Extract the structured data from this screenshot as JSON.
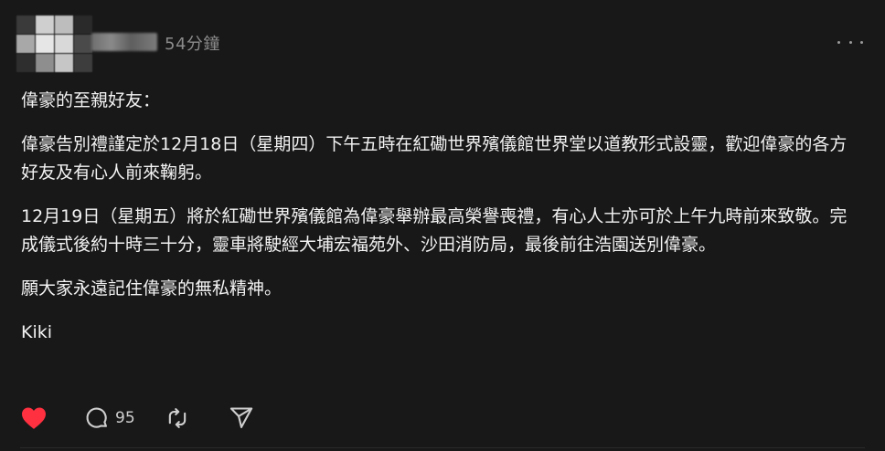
{
  "header": {
    "timestamp": "54分鐘",
    "more_icon": "more-horizontal-icon"
  },
  "post": {
    "paragraphs": [
      "偉豪的至親好友：",
      "偉豪告別禮謹定於12月18日（星期四）下午五時在紅磡世界殯儀館世界堂以道教形式設靈，歡迎偉豪的各方好友及有心人前來鞠躬。",
      "12月19日（星期五）將於紅磡世界殯儀館為偉豪舉辦最高榮譽喪禮，有心人士亦可於上午九時前來致敬。完成儀式後約十時三十分，靈車將駛經大埔宏福苑外、沙田消防局，最後前往浩園送別偉豪。",
      "願大家永遠記住偉豪的無私精神。",
      "Kiki"
    ]
  },
  "actions": {
    "like_icon": "heart-filled-icon",
    "comment_icon": "comment-bubble-icon",
    "comment_count": "95",
    "repost_icon": "repost-icon",
    "share_icon": "send-icon"
  },
  "colors": {
    "background": "#181818",
    "text": "#f3f3f3",
    "muted": "#8b8b8b",
    "like": "#ff3040"
  }
}
